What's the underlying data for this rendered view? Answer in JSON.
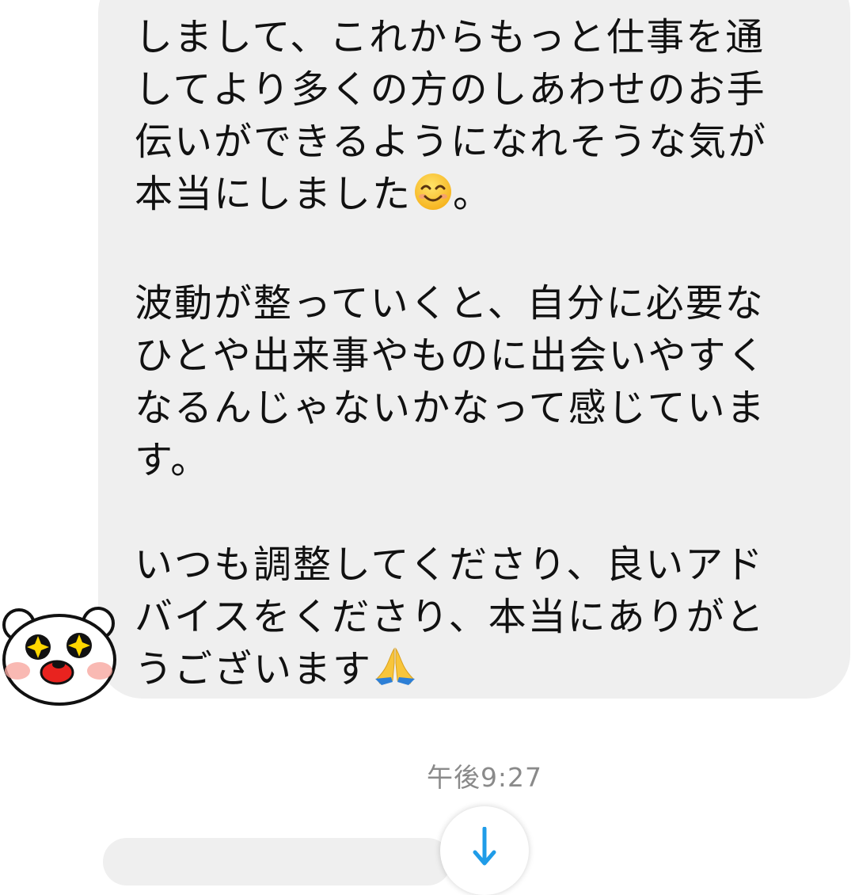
{
  "message": {
    "paragraphs": [
      {
        "lines": [
          "しまして、これからもっと仕事を通",
          "してより多くの方のしあわせのお手",
          "伝いができるようになれそうな気が",
          "本当にしました"
        ],
        "trailing_emoji": "smiling-face-emoji",
        "trailing_text": "。"
      },
      {
        "lines": [
          "波動が整っていくと、自分に必要な",
          "ひとや出来事やものに出会いやすく",
          "なるんじゃないかなって感じていま",
          "す。"
        ]
      },
      {
        "lines": [
          "いつも調整してくださり、良いアド",
          "バイスをくださり、本当にありがと",
          "うございます"
        ],
        "trailing_emoji": "folded-hands-emoji"
      }
    ]
  },
  "timestamp": "午後9:27",
  "avatar": {
    "icon": "white-bear-sticker-icon"
  },
  "scroll_button": {
    "icon": "arrow-down-icon",
    "color": "#1f9ce8"
  },
  "colors": {
    "bubble_background": "#efefef",
    "message_text": "#111111",
    "timestamp_text": "#8a8a8a"
  }
}
